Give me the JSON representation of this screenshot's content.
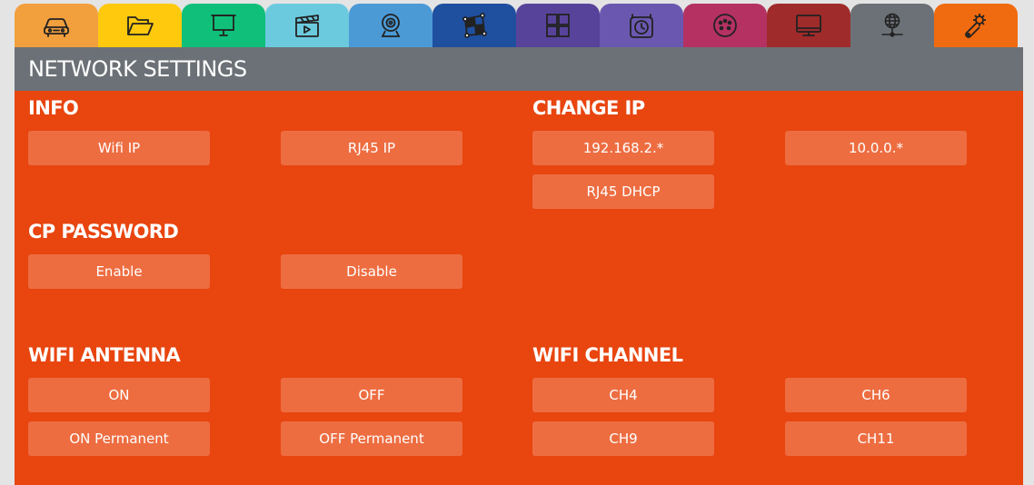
{
  "tabs": [
    {
      "icon": "car-icon",
      "color": "#f29f3e"
    },
    {
      "icon": "folder-icon",
      "color": "#ffc90e"
    },
    {
      "icon": "projector-screen-icon",
      "color": "#10c07a"
    },
    {
      "icon": "clapperboard-icon",
      "color": "#6ccadf"
    },
    {
      "icon": "webcam-icon",
      "color": "#4b9ad6"
    },
    {
      "icon": "mapping-surface-icon",
      "color": "#1f4f9f"
    },
    {
      "icon": "grid-icon",
      "color": "#58439b"
    },
    {
      "icon": "timer-icon",
      "color": "#6a58b0"
    },
    {
      "icon": "dmx-connector-icon",
      "color": "#b43162"
    },
    {
      "icon": "monitor-icon",
      "color": "#a02b2b"
    },
    {
      "icon": "network-icon",
      "color": "#6c7177",
      "active": true
    },
    {
      "icon": "tools-icon",
      "color": "#f06a0f"
    }
  ],
  "header": {
    "title": "NETWORK SETTINGS"
  },
  "sections": {
    "info": {
      "title": "INFO",
      "buttons": {
        "wifi_ip": "Wifi IP",
        "rj45_ip": "RJ45 IP"
      }
    },
    "change_ip": {
      "title": "CHANGE IP",
      "buttons": {
        "ip_192": "192.168.2.*",
        "ip_10": "10.0.0.*",
        "rj45_dhcp": "RJ45 DHCP"
      }
    },
    "cp_password": {
      "title": "CP PASSWORD",
      "buttons": {
        "enable": "Enable",
        "disable": "Disable"
      }
    },
    "wifi_antenna": {
      "title": "WIFI ANTENNA",
      "buttons": {
        "on": "ON",
        "off": "OFF",
        "on_permanent": "ON Permanent",
        "off_permanent": "OFF Permanent"
      }
    },
    "wifi_channel": {
      "title": "WIFI CHANNEL",
      "buttons": {
        "ch4": "CH4",
        "ch6": "CH6",
        "ch9": "CH9",
        "ch11": "CH11"
      }
    }
  },
  "colors": {
    "panel": "#e8450f",
    "button": "#ed6d41",
    "header": "#6c7177"
  }
}
